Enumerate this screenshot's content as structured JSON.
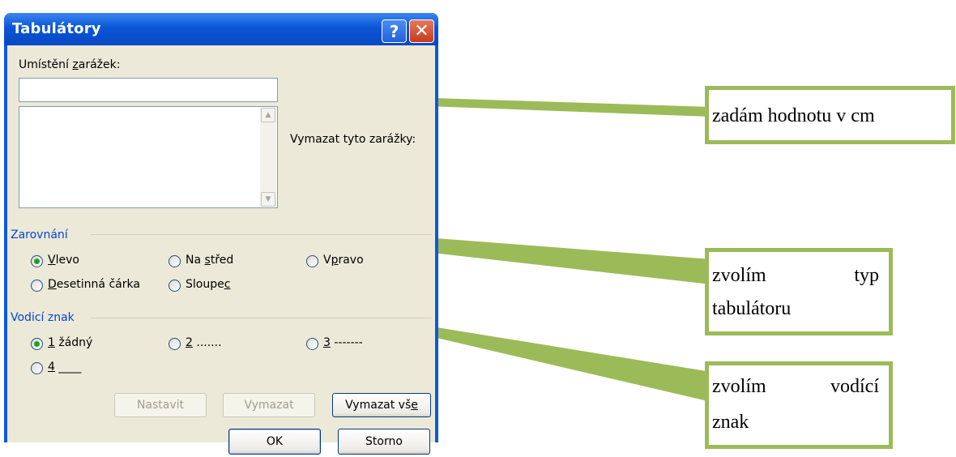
{
  "dialog": {
    "title": "Tabulátory",
    "help_glyph": "?",
    "close_glyph": "✕"
  },
  "tab_stop": {
    "label_pre": "Umístění ",
    "label_ul": "z",
    "label_post": "arážek:",
    "value": "",
    "clear_label": "Vymazat tyto zarážky:"
  },
  "alignment": {
    "group_label": "Zarovnání",
    "options": [
      {
        "pre": "",
        "ul": "V",
        "post": "levo",
        "selected": true
      },
      {
        "pre": "Na ",
        "ul": "s",
        "post": "třed",
        "selected": false
      },
      {
        "pre": "V",
        "ul": "p",
        "post": "ravo",
        "selected": false
      },
      {
        "pre": "",
        "ul": "D",
        "post": "esetinná čárka",
        "selected": false
      },
      {
        "pre": "Sloupe",
        "ul": "c",
        "post": "",
        "selected": false
      }
    ]
  },
  "leader": {
    "group_label": "Vodicí znak",
    "options": [
      {
        "ul": "1",
        "post": " žádný",
        "selected": true
      },
      {
        "ul": "2",
        "post": " .......",
        "selected": false
      },
      {
        "ul": "3",
        "post": " -------",
        "selected": false
      },
      {
        "ul": "4",
        "post": " ____",
        "selected": false
      }
    ]
  },
  "buttons": {
    "set": "Nastavit",
    "clear": "Vymazat",
    "clear_all_pre": "Vymazat vš",
    "clear_all_ul": "e",
    "ok": "OK",
    "cancel": "Storno"
  },
  "callouts": {
    "c1": "zadám hodnotu v cm",
    "c2_w1": "zvolím",
    "c2_w2": "typ",
    "c2_line2": "tabulátoru",
    "c3_w1": "zvolím",
    "c3_w2": "vodící",
    "c3_line2": "znak",
    "border_color": "#9bbb59"
  }
}
